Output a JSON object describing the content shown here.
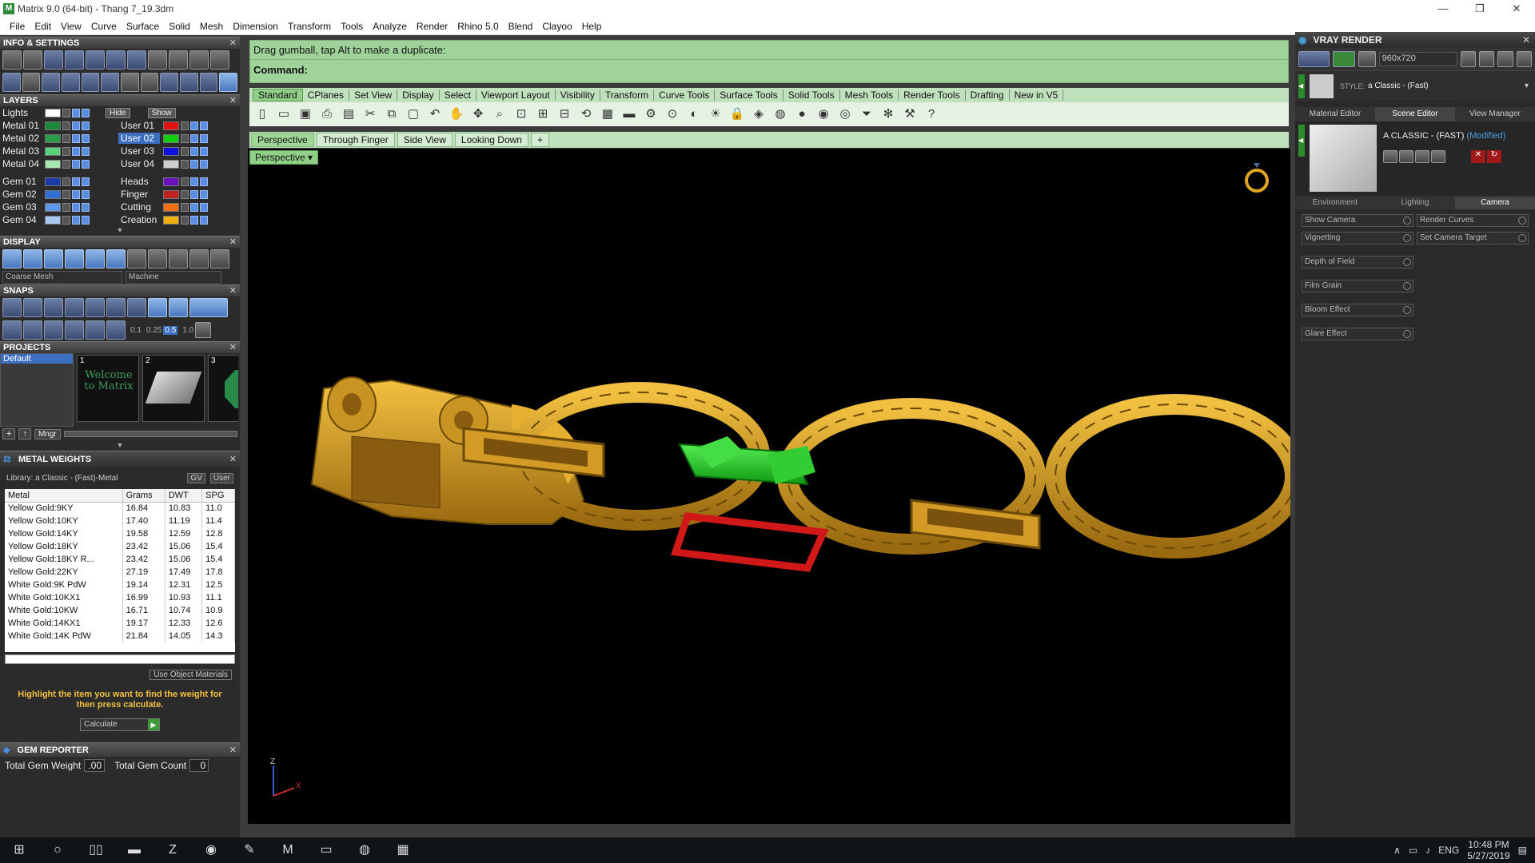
{
  "window": {
    "title": "Matrix 9.0 (64-bit) - Thang 7_19.3dm",
    "app_icon": "matrix-app-icon",
    "buttons": [
      "minimize",
      "restore",
      "close"
    ]
  },
  "menu": [
    "File",
    "Edit",
    "View",
    "Curve",
    "Surface",
    "Solid",
    "Mesh",
    "Dimension",
    "Transform",
    "Tools",
    "Analyze",
    "Render",
    "Rhino 5.0",
    "Blend",
    "Clayoo",
    "Help"
  ],
  "left": {
    "info_title": "INFO & SETTINGS",
    "layers_title": "LAYERS",
    "lights_label": "Lights",
    "hide_label": "Hide",
    "show_label": "Show",
    "layers_left": [
      {
        "name": "Metal 01",
        "color": "#1a8a3a"
      },
      {
        "name": "Metal 02",
        "color": "#2a9a4a"
      },
      {
        "name": "Metal 03",
        "color": "#5ad27a"
      },
      {
        "name": "Metal 04",
        "color": "#a8e8b0"
      },
      {
        "name": "Gem 01",
        "color": "#1a3aa8"
      },
      {
        "name": "Gem 02",
        "color": "#2f6fd6"
      },
      {
        "name": "Gem 03",
        "color": "#5f98e8"
      },
      {
        "name": "Gem 04",
        "color": "#a8c8f0"
      }
    ],
    "layers_right": [
      {
        "name": "User 01",
        "color": "#e01010",
        "selected": false
      },
      {
        "name": "User 02",
        "color": "#10d010",
        "selected": true
      },
      {
        "name": "User 03",
        "color": "#1010e0",
        "selected": false
      },
      {
        "name": "User 04",
        "color": "#d0d0d0",
        "selected": false
      },
      {
        "name": "Heads",
        "color": "#6a10c0",
        "selected": false
      },
      {
        "name": "Finger",
        "color": "#c02020",
        "selected": false
      },
      {
        "name": "Cutting",
        "color": "#f07010",
        "selected": false
      },
      {
        "name": "Creation",
        "color": "#f0b010",
        "selected": false
      }
    ],
    "display_title": "DISPLAY",
    "mesh_select": "Coarse Mesh",
    "machine_select": "Machine",
    "snaps_title": "SNAPS",
    "snap_values": [
      "0.1",
      "0.25",
      "0.5",
      "1.0"
    ],
    "projects_title": "PROJECTS",
    "project_default": "Default",
    "project_thumbs": [
      {
        "num": "1",
        "label": "Welcome to Matrix"
      },
      {
        "num": "2",
        "label": ""
      },
      {
        "num": "3",
        "label": ""
      }
    ],
    "mngr_label": "Mngr",
    "metal_title": "METAL WEIGHTS",
    "library_label": "Library: a Classic - (Fast)-Metal",
    "gv_label": "GV",
    "user_label": "User",
    "metal_headers": [
      "Metal",
      "Grams",
      "DWT",
      "SPG"
    ],
    "metal_rows": [
      [
        "Yellow Gold:9KY",
        "16.84",
        "10.83",
        "11.0"
      ],
      [
        "Yellow Gold:10KY",
        "17.40",
        "11.19",
        "11.4"
      ],
      [
        "Yellow Gold:14KY",
        "19.58",
        "12.59",
        "12.8"
      ],
      [
        "Yellow Gold:18KY",
        "23.42",
        "15.06",
        "15.4"
      ],
      [
        "Yellow Gold:18KY R...",
        "23.42",
        "15.06",
        "15.4"
      ],
      [
        "Yellow Gold:22KY",
        "27.19",
        "17.49",
        "17.8"
      ],
      [
        "White Gold:9K PdW",
        "19.14",
        "12.31",
        "12.5"
      ],
      [
        "White Gold:10KX1",
        "16.99",
        "10.93",
        "11.1"
      ],
      [
        "White Gold:10KW",
        "16.71",
        "10.74",
        "10.9"
      ],
      [
        "White Gold:14KX1",
        "19.17",
        "12.33",
        "12.6"
      ],
      [
        "White Gold:14K PdW",
        "21.84",
        "14.05",
        "14.3"
      ]
    ],
    "use_object_materials": "Use Object Materials",
    "highlight_text": "Highlight the item you want to find the weight for then press calculate.",
    "calculate_label": "Calculate",
    "gem_title": "GEM REPORTER",
    "total_gem_weight_label": "Total Gem Weight",
    "total_gem_weight": ".00",
    "total_gem_count_label": "Total Gem Count",
    "total_gem_count": "0"
  },
  "command": {
    "line1": "Drag gumball, tap Alt to make a duplicate:",
    "line2": "Command:"
  },
  "toolbar_tabs": [
    "Standard",
    "CPlanes",
    "Set View",
    "Display",
    "Select",
    "Viewport Layout",
    "Visibility",
    "Transform",
    "Curve Tools",
    "Surface Tools",
    "Solid Tools",
    "Mesh Tools",
    "Render Tools",
    "Drafting",
    "New in V5"
  ],
  "toolbar_icons": [
    "new-icon",
    "open-icon",
    "save-icon",
    "print-icon",
    "import-icon",
    "cut-icon",
    "copy-icon",
    "paste-icon",
    "undo-icon",
    "pan-icon",
    "move-icon",
    "zoom-icon",
    "zoom-window-icon",
    "zoom-extents-icon",
    "zoom-selected-icon",
    "rotate-view-icon",
    "grid-icon",
    "car-icon",
    "tools-icon",
    "snap-icon",
    "shade-icon",
    "light-icon",
    "lock-icon",
    "layer-icon",
    "color-icon",
    "sphere-icon",
    "render-icon",
    "material-icon",
    "filter-icon",
    "settings-icon",
    "options-icon",
    "help-icon"
  ],
  "view_tabs": [
    "Perspective",
    "Through Finger",
    "Side View",
    "Looking Down"
  ],
  "viewport": {
    "label": "Perspective",
    "axis_z": "Z",
    "axis_x": "X",
    "gold_color": "#e0a423",
    "green_color": "#22c22e",
    "red_color": "#d01818"
  },
  "right": {
    "title": "VRAY RENDER",
    "resolution": "960x720",
    "style_label": "STYLE:",
    "style_value": "a Classic - (Fast)",
    "tabs": [
      "Material Editor",
      "Scene Editor",
      "View Manager"
    ],
    "scene_name": "A CLASSIC - (FAST)",
    "scene_modified": "(Modified)",
    "sub_tabs": [
      "Environment",
      "Lighting",
      "Camera"
    ],
    "options_row1": [
      "Show Camera",
      "Render Curves"
    ],
    "options_row2": [
      "Vignetting",
      "Set Camera Target"
    ],
    "options_single": [
      "Depth of Field",
      "Film Grain",
      "Bloom Effect",
      "Glare Effect"
    ]
  },
  "taskbar": {
    "apps": [
      "windows-start-icon",
      "search-circle-icon",
      "task-view-icon",
      "file-explorer-icon",
      "zalo-icon",
      "chrome-icon",
      "sketch-icon",
      "matrix-icon",
      "photo-icon",
      "viber-icon",
      "notes-icon"
    ],
    "lang": "ENG",
    "time": "10:48 PM",
    "date": "5/27/2019"
  }
}
